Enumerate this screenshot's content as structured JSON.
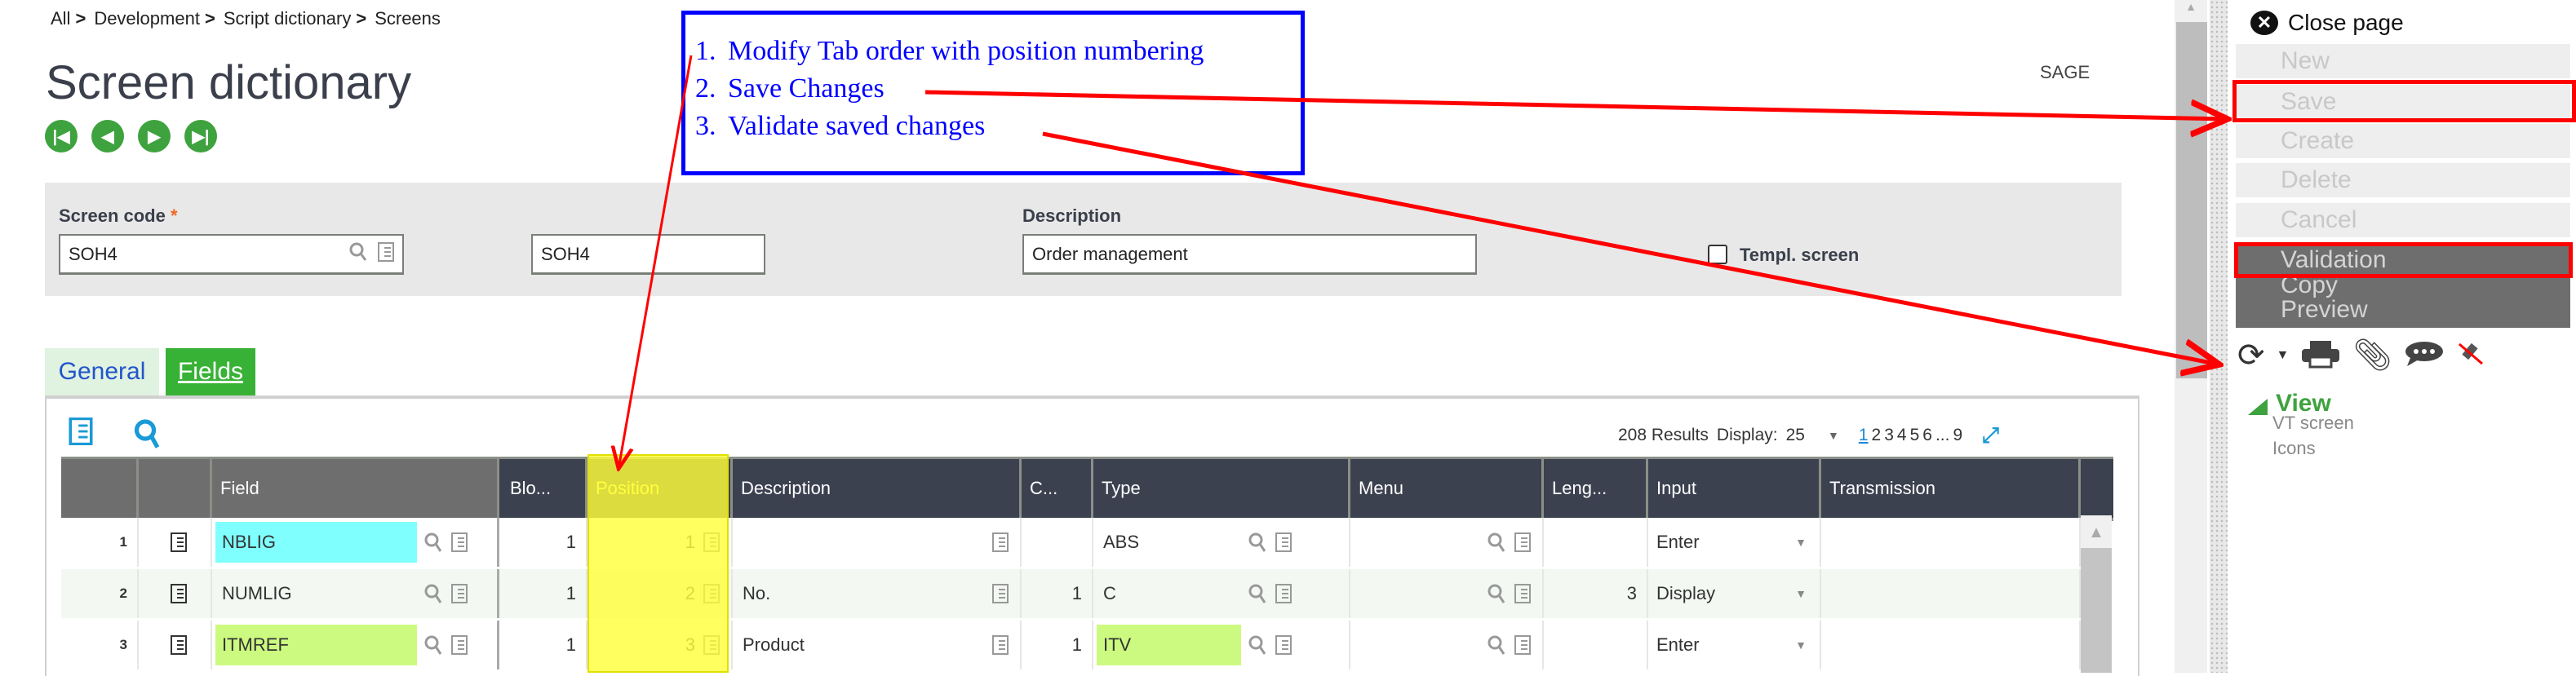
{
  "breadcrumb": [
    "All",
    "Development",
    "Script dictionary",
    "Screens"
  ],
  "breadcrumb_sep": ">",
  "page_title": "Screen dictionary",
  "brand": "SAGE",
  "nav_icons": [
    "first-record-icon",
    "previous-record-icon",
    "next-record-icon",
    "last-record-icon"
  ],
  "form": {
    "screen_code_label": "Screen code",
    "required_mark": "*",
    "screen_code_value": "SOH4",
    "screen_code2_value": "SOH4",
    "description_label": "Description",
    "description_value": "Order management",
    "templ_screen_label": "Templ. screen",
    "templ_screen_checked": false
  },
  "annotation": {
    "steps": [
      {
        "num": "1.",
        "text": "Modify Tab order with position numbering"
      },
      {
        "num": "2.",
        "text": "Save Changes"
      },
      {
        "num": "3.",
        "text": "Validate saved changes"
      }
    ],
    "box_color": "#0000ff",
    "arrow_color": "#ff0000"
  },
  "tabs": [
    {
      "label": "General",
      "active": false
    },
    {
      "label": "Fields",
      "active": true
    }
  ],
  "grid": {
    "results": "208 Results",
    "display_label": "Display:",
    "display_value": "25",
    "pages": [
      "1",
      "2",
      "3",
      "4",
      "5",
      "6",
      "...",
      "9"
    ],
    "current_page": "1",
    "columns": [
      "",
      "",
      "Field",
      "Blo...",
      "Position",
      "Description",
      "C...",
      "Type",
      "Menu",
      "Leng...",
      "Input",
      "Transmission"
    ],
    "rows": [
      {
        "num": "1",
        "field": "NBLIG",
        "field_color": "#80ffff",
        "block": "1",
        "position": "1",
        "description": "",
        "c": "",
        "type": "ABS",
        "type_color": "",
        "menu": "",
        "length": "",
        "input": "Enter",
        "transmission": ""
      },
      {
        "num": "2",
        "field": "NUMLIG",
        "field_color": "",
        "block": "1",
        "position": "2",
        "description": "No.",
        "c": "1",
        "type": "C",
        "type_color": "",
        "menu": "",
        "length": "3",
        "input": "Display",
        "transmission": ""
      },
      {
        "num": "3",
        "field": "ITMREF",
        "field_color": "#ccfa80",
        "block": "1",
        "position": "3",
        "description": "Product",
        "c": "1",
        "type": "ITV",
        "type_color": "#ccfa80",
        "menu": "",
        "length": "",
        "input": "Enter",
        "transmission": ""
      }
    ]
  },
  "right_panel": {
    "close_label": "Close page",
    "actions": [
      {
        "label": "New",
        "enabled": false
      },
      {
        "label": "Save",
        "enabled": false
      },
      {
        "label": "Create",
        "enabled": false
      },
      {
        "label": "Delete",
        "enabled": false
      },
      {
        "label": "Cancel",
        "enabled": false
      }
    ],
    "menu_actions": [
      "Validation",
      "Copy",
      "Preview"
    ],
    "tool_icons": [
      "refresh-icon",
      "dropdown-caret-icon",
      "print-icon",
      "attachment-icon",
      "comment-icon",
      "unpin-icon"
    ],
    "view_label": "View",
    "view_items": [
      "VT screen",
      "Icons"
    ]
  }
}
